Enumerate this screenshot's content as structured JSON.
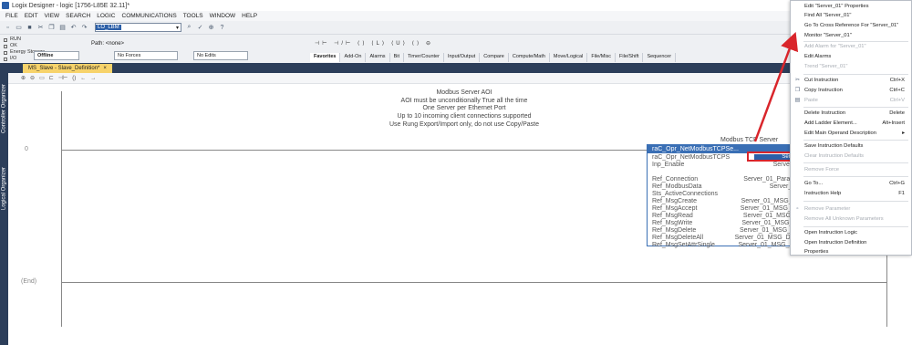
{
  "window": {
    "title": "Logix Designer - logic [1756-L85E 32.11]*"
  },
  "menubar": [
    "FILE",
    "EDIT",
    "VIEW",
    "SEARCH",
    "LOGIC",
    "COMMUNICATIONS",
    "TOOLS",
    "WINDOW",
    "HELP"
  ],
  "toolbar": {
    "routine_value": "LO_LBM"
  },
  "status": {
    "labels": [
      "RUN",
      "OK",
      "Energy Storage",
      "I/O"
    ],
    "mode": "Offline",
    "forces": "No Forces",
    "edits": "No Edits",
    "path_label": "Path:",
    "path_value": "<none>"
  },
  "instruction_tabs": [
    "Favorites",
    "Add-On",
    "Alarms",
    "Bit",
    "Timer/Counter",
    "Input/Output",
    "Compare",
    "Compute/Math",
    "Move/Logical",
    "File/Misc",
    "File/Shift",
    "Sequencer"
  ],
  "side_tabs": [
    "Controller Organizer",
    "Logical Organizer"
  ],
  "document_tab": {
    "label": "MS_Slave - Slave_Definition*",
    "close": "×"
  },
  "ladder": {
    "rung0_label": "0",
    "end_label": "(End)",
    "comment": [
      "Modbus Server AOI",
      "AOI must be unconditionally True all the time",
      "One Server per Ethernet Port",
      "Up to 10 incoming client connections supported",
      "Use Rung Export/Import only, do not use Copy/Paste"
    ],
    "aoi": {
      "name": "Modbus TCP Server",
      "header": "raC_Opr_NetModbusTCPSe...",
      "highlight_value": "Server",
      "rows": [
        {
          "n": "raC_Opr_NetModbusTCPS",
          "v": ""
        },
        {
          "n": "Inp_Enable",
          "v": "Server_0"
        },
        {
          "n": "",
          "v": ""
        },
        {
          "n": "Ref_Connection",
          "v": "Server_01_Parame"
        },
        {
          "n": "Ref_ModbusData",
          "v": "Server_01"
        },
        {
          "n": "Sts_ActiveConnections",
          "v": ""
        },
        {
          "n": "Ref_MsgCreate",
          "v": "Server_01_MSG_Cr"
        },
        {
          "n": "Ref_MsgAccept",
          "v": "Server_01_MSG_Ac"
        },
        {
          "n": "Ref_MsgRead",
          "v": "Server_01_MSG_R"
        },
        {
          "n": "Ref_MsgWrite",
          "v": "Server_01_MSG_W"
        },
        {
          "n": "Ref_MsgDelete",
          "v": "Server_01_MSG_De"
        },
        {
          "n": "Ref_MsgDeleteAll",
          "v": "Server_01_MSG_Dele"
        },
        {
          "n": "Ref_MsgSetAttrSingle",
          "v": "Server_01_MSG_Set"
        }
      ]
    }
  },
  "context_menu": [
    {
      "label": "Edit \"Server_01\" Properties",
      "shortcut": "",
      "disabled": false
    },
    {
      "label": "Find All \"Server_01\"",
      "shortcut": "",
      "disabled": false
    },
    {
      "label": "Go To Cross Reference For \"Server_01\"",
      "shortcut": "",
      "disabled": false
    },
    {
      "label": "Monitor \"Server_01\"",
      "shortcut": "",
      "disabled": false
    },
    {
      "label": "Add Alarm for \"Server_01\"",
      "shortcut": "",
      "disabled": true
    },
    {
      "label": "Edit Alarms",
      "shortcut": "",
      "disabled": false
    },
    {
      "label": "Trend \"Server_01\"",
      "shortcut": "",
      "disabled": true
    },
    {
      "label": "Cut Instruction",
      "shortcut": "Ctrl+X",
      "disabled": false
    },
    {
      "label": "Copy Instruction",
      "shortcut": "Ctrl+C",
      "disabled": false
    },
    {
      "label": "Paste",
      "shortcut": "Ctrl+V",
      "disabled": true
    },
    {
      "label": "Delete Instruction",
      "shortcut": "Delete",
      "disabled": false
    },
    {
      "label": "Add Ladder Element...",
      "shortcut": "Alt+Insert",
      "disabled": false
    },
    {
      "label": "Edit Main Operand Description",
      "shortcut": "▸",
      "disabled": false
    },
    {
      "label": "Save Instruction Defaults",
      "shortcut": "",
      "disabled": false
    },
    {
      "label": "Clear Instruction Defaults",
      "shortcut": "",
      "disabled": true
    },
    {
      "label": "Remove Force",
      "shortcut": "",
      "disabled": true
    },
    {
      "label": "Go To...",
      "shortcut": "Ctrl+G",
      "disabled": false
    },
    {
      "label": "Instruction Help",
      "shortcut": "F1",
      "disabled": false
    },
    {
      "label": "Remove Parameter",
      "shortcut": "",
      "disabled": true
    },
    {
      "label": "Remove All Unknown Parameters",
      "shortcut": "",
      "disabled": true
    },
    {
      "label": "Open Instruction Logic",
      "shortcut": "",
      "disabled": false
    },
    {
      "label": "Open Instruction Definition",
      "shortcut": "",
      "disabled": false
    },
    {
      "label": "Properties",
      "shortcut": "",
      "disabled": false
    }
  ],
  "colors": {
    "accent": "#2b5fa8",
    "annotation_red": "#d9252b",
    "dark_strip": "#2c3e5a",
    "doc_tab": "#f7d36b"
  }
}
